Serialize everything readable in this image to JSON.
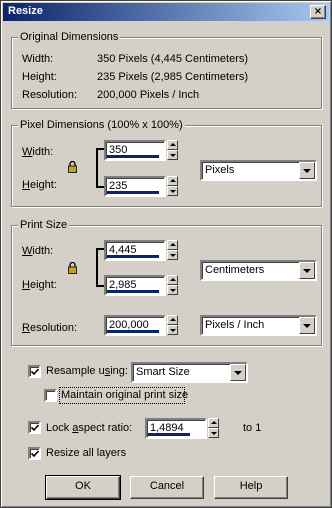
{
  "window": {
    "title": "Resize",
    "close_glyph": "×"
  },
  "original": {
    "legend": "Original Dimensions",
    "width_label": "Width:",
    "width_value": "350 Pixels (4,445 Centimeters)",
    "height_label": "Height:",
    "height_value": "235 Pixels (2,985 Centimeters)",
    "resolution_label": "Resolution:",
    "resolution_value": "200,000 Pixels / Inch"
  },
  "pixel": {
    "legend": "Pixel Dimensions (100% x 100%)",
    "width_label_pre": "W",
    "width_label_post": "idth:",
    "width_value": "350",
    "height_label_pre": "H",
    "height_label_post": "eight:",
    "height_value": "235",
    "unit": "Pixels"
  },
  "print": {
    "legend": "Print Size",
    "width_label_pre": "W",
    "width_label_post": "idth:",
    "width_value": "4,445",
    "height_label_pre": "H",
    "height_label_post": "eight:",
    "height_value": "2,985",
    "unit": "Centimeters",
    "resolution_label_pre": "R",
    "resolution_label_post": "esolution:",
    "resolution_value": "200,000",
    "resolution_unit": "Pixels / Inch"
  },
  "options": {
    "resample_pre": "Resample u",
    "resample_u": "s",
    "resample_post": "ing:",
    "resample_checked": true,
    "resample_method": "Smart Size",
    "maintain_label": "Maintain original print size",
    "maintain_checked": false,
    "lock_pre": "Lock ",
    "lock_u": "a",
    "lock_post": "spect ratio:",
    "lock_checked": true,
    "aspect_value": "1,4894",
    "aspect_suffix": "to 1",
    "resize_layers_label": "Resize all layers",
    "resize_layers_checked": true
  },
  "buttons": {
    "ok": "OK",
    "cancel": "Cancel",
    "help": "Help"
  },
  "colors": {
    "accent": "#0a246a",
    "face": "#d4d0c8"
  }
}
